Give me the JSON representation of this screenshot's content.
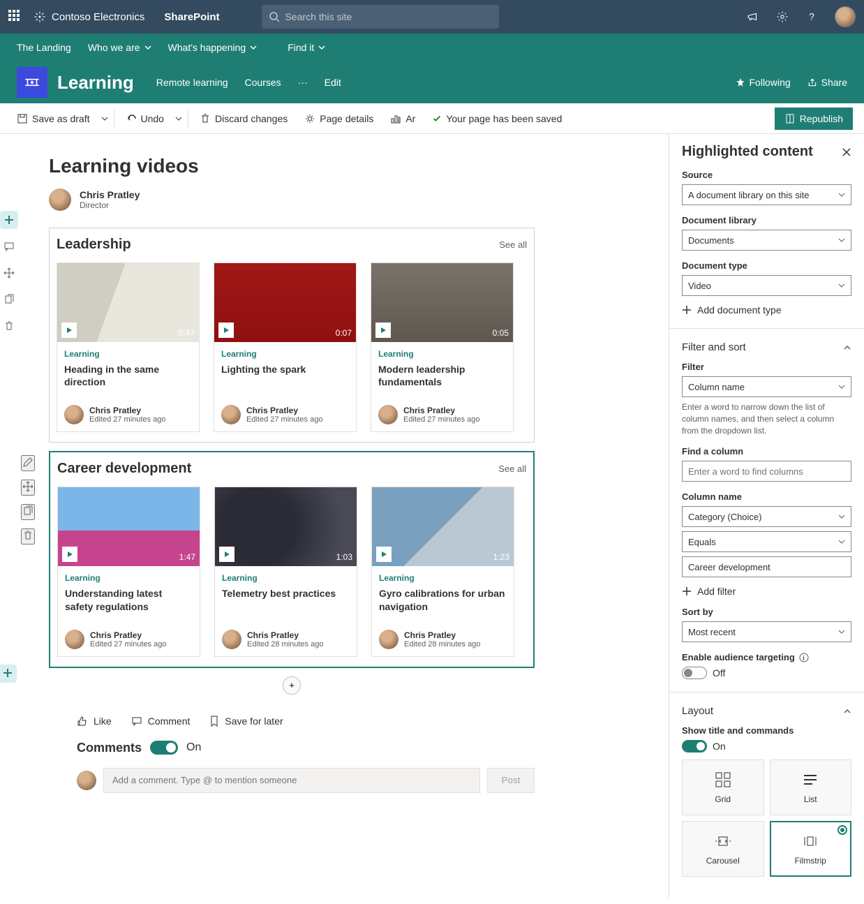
{
  "suite": {
    "brand": "Contoso Electronics",
    "app": "SharePoint",
    "search_placeholder": "Search this site"
  },
  "hub_nav": [
    {
      "label": "The Landing",
      "has_dropdown": false
    },
    {
      "label": "Who we are",
      "has_dropdown": true
    },
    {
      "label": "What's happening",
      "has_dropdown": true
    },
    {
      "label": "Find it",
      "has_dropdown": true
    }
  ],
  "site": {
    "title": "Learning",
    "nav": [
      "Remote learning",
      "Courses"
    ],
    "edit": "Edit",
    "following": "Following",
    "share": "Share"
  },
  "cmdbar": {
    "save_draft": "Save as draft",
    "undo": "Undo",
    "discard": "Discard changes",
    "page_details": "Page details",
    "ar": "Ar",
    "saved_msg": "Your page has been saved",
    "republish": "Republish"
  },
  "page": {
    "title": "Learning videos",
    "author_name": "Chris Pratley",
    "author_role": "Director"
  },
  "sections": [
    {
      "title": "Leadership",
      "see_all": "See all",
      "cards": [
        {
          "category": "Learning",
          "title": "Heading in the same direction",
          "duration": "0:47",
          "author": "Chris Pratley",
          "edited": "Edited 27 minutes ago",
          "thumb": "t0"
        },
        {
          "category": "Learning",
          "title": "Lighting the spark",
          "duration": "0:07",
          "author": "Chris Pratley",
          "edited": "Edited 27 minutes ago",
          "thumb": "t1"
        },
        {
          "category": "Learning",
          "title": "Modern leadership fundamentals",
          "duration": "0:05",
          "author": "Chris Pratley",
          "edited": "Edited 27 minutes ago",
          "thumb": "t2"
        }
      ]
    },
    {
      "title": "Career development",
      "see_all": "See all",
      "selected": true,
      "cards": [
        {
          "category": "Learning",
          "title": "Understanding latest safety regulations",
          "duration": "1:47",
          "author": "Chris Pratley",
          "edited": "Edited 27 minutes ago",
          "thumb": "t3"
        },
        {
          "category": "Learning",
          "title": "Telemetry best practices",
          "duration": "1:03",
          "author": "Chris Pratley",
          "edited": "Edited 28 minutes ago",
          "thumb": "t4"
        },
        {
          "category": "Learning",
          "title": "Gyro calibrations for urban navigation",
          "duration": "1:23",
          "author": "Chris Pratley",
          "edited": "Edited 28 minutes ago",
          "thumb": "t5"
        }
      ]
    }
  ],
  "social": {
    "like": "Like",
    "comment": "Comment",
    "save": "Save for later",
    "comments_heading": "Comments",
    "comments_state": "On",
    "comment_placeholder": "Add a comment. Type @ to mention someone",
    "post": "Post"
  },
  "panel": {
    "title": "Highlighted content",
    "source_label": "Source",
    "source_value": "A document library on this site",
    "doclib_label": "Document library",
    "doclib_value": "Documents",
    "doctype_label": "Document type",
    "doctype_value": "Video",
    "add_doctype": "Add document type",
    "filter_sort_heading": "Filter and sort",
    "filter_label": "Filter",
    "filter_value": "Column name",
    "filter_help": "Enter a word to narrow down the list of column names, and then select a column from the dropdown list.",
    "find_column_label": "Find a column",
    "find_column_placeholder": "Enter a word to find columns",
    "column_name_label": "Column name",
    "column_name_value": "Category (Choice)",
    "operator_value": "Equals",
    "value_value": "Career development",
    "add_filter": "Add filter",
    "sortby_label": "Sort by",
    "sortby_value": "Most recent",
    "audience_label": "Enable audience targeting",
    "audience_state": "Off",
    "layout_heading": "Layout",
    "show_title_label": "Show title and commands",
    "show_title_state": "On",
    "layouts": [
      "Grid",
      "List",
      "Carousel",
      "Filmstrip"
    ],
    "layout_selected": "Filmstrip"
  }
}
